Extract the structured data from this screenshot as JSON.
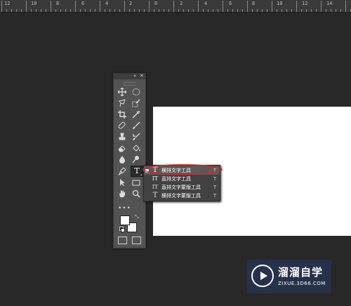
{
  "ruler": {
    "labels": [
      "12",
      "10",
      "8",
      "6",
      "4",
      "2",
      "0",
      "2",
      "4",
      "6",
      "8",
      "10",
      "12",
      "14"
    ]
  },
  "toolbox": {
    "collapse_icon": "double-arrow-icon",
    "close_icon": "close-icon",
    "tools": [
      {
        "name": "move-tool",
        "icon": "move-icon"
      },
      {
        "name": "elliptical-marquee-tool",
        "icon": "ellipse-marquee-icon"
      },
      {
        "name": "lasso-tool",
        "icon": "lasso-icon"
      },
      {
        "name": "quick-selection-tool",
        "icon": "quick-select-icon"
      },
      {
        "name": "crop-tool",
        "icon": "crop-icon"
      },
      {
        "name": "eyedropper-tool",
        "icon": "eyedropper-icon"
      },
      {
        "name": "healing-brush-tool",
        "icon": "bandage-icon"
      },
      {
        "name": "brush-tool",
        "icon": "brush-icon"
      },
      {
        "name": "clone-stamp-tool",
        "icon": "stamp-icon"
      },
      {
        "name": "history-brush-tool",
        "icon": "history-brush-icon"
      },
      {
        "name": "eraser-tool",
        "icon": "eraser-icon"
      },
      {
        "name": "paint-bucket-tool",
        "icon": "bucket-icon"
      },
      {
        "name": "blur-tool",
        "icon": "drop-icon"
      },
      {
        "name": "dodge-tool",
        "icon": "dodge-icon"
      },
      {
        "name": "pen-tool",
        "icon": "pen-icon"
      },
      {
        "name": "type-tool",
        "icon": "type-icon",
        "glyph": "T"
      },
      {
        "name": "path-selection-tool",
        "icon": "arrow-cursor-icon"
      },
      {
        "name": "rectangle-tool",
        "icon": "rectangle-icon"
      },
      {
        "name": "hand-tool",
        "icon": "hand-icon"
      },
      {
        "name": "zoom-tool",
        "icon": "magnifier-icon"
      }
    ],
    "more": "•••",
    "foreground_color": "#ffffff",
    "background_color": "#ffffff"
  },
  "flyout": {
    "items": [
      {
        "label": "横排文字工具",
        "shortcut": "T",
        "glyph": "T",
        "selected": true
      },
      {
        "label": "直排文字工具",
        "shortcut": "T",
        "glyph": "IT",
        "selected": false
      },
      {
        "label": "直排文字蒙版工具",
        "shortcut": "T",
        "glyph": "IT",
        "selected": false
      },
      {
        "label": "横排文字蒙版工具",
        "shortcut": "T",
        "glyph": "T",
        "selected": false
      }
    ]
  },
  "watermark": {
    "brand": "溜溜自学",
    "url": "ZIXUE.3D66.COM"
  },
  "colors": {
    "workspace": "#282828",
    "panel": "#535353",
    "highlight_ring": "#d9252a"
  }
}
